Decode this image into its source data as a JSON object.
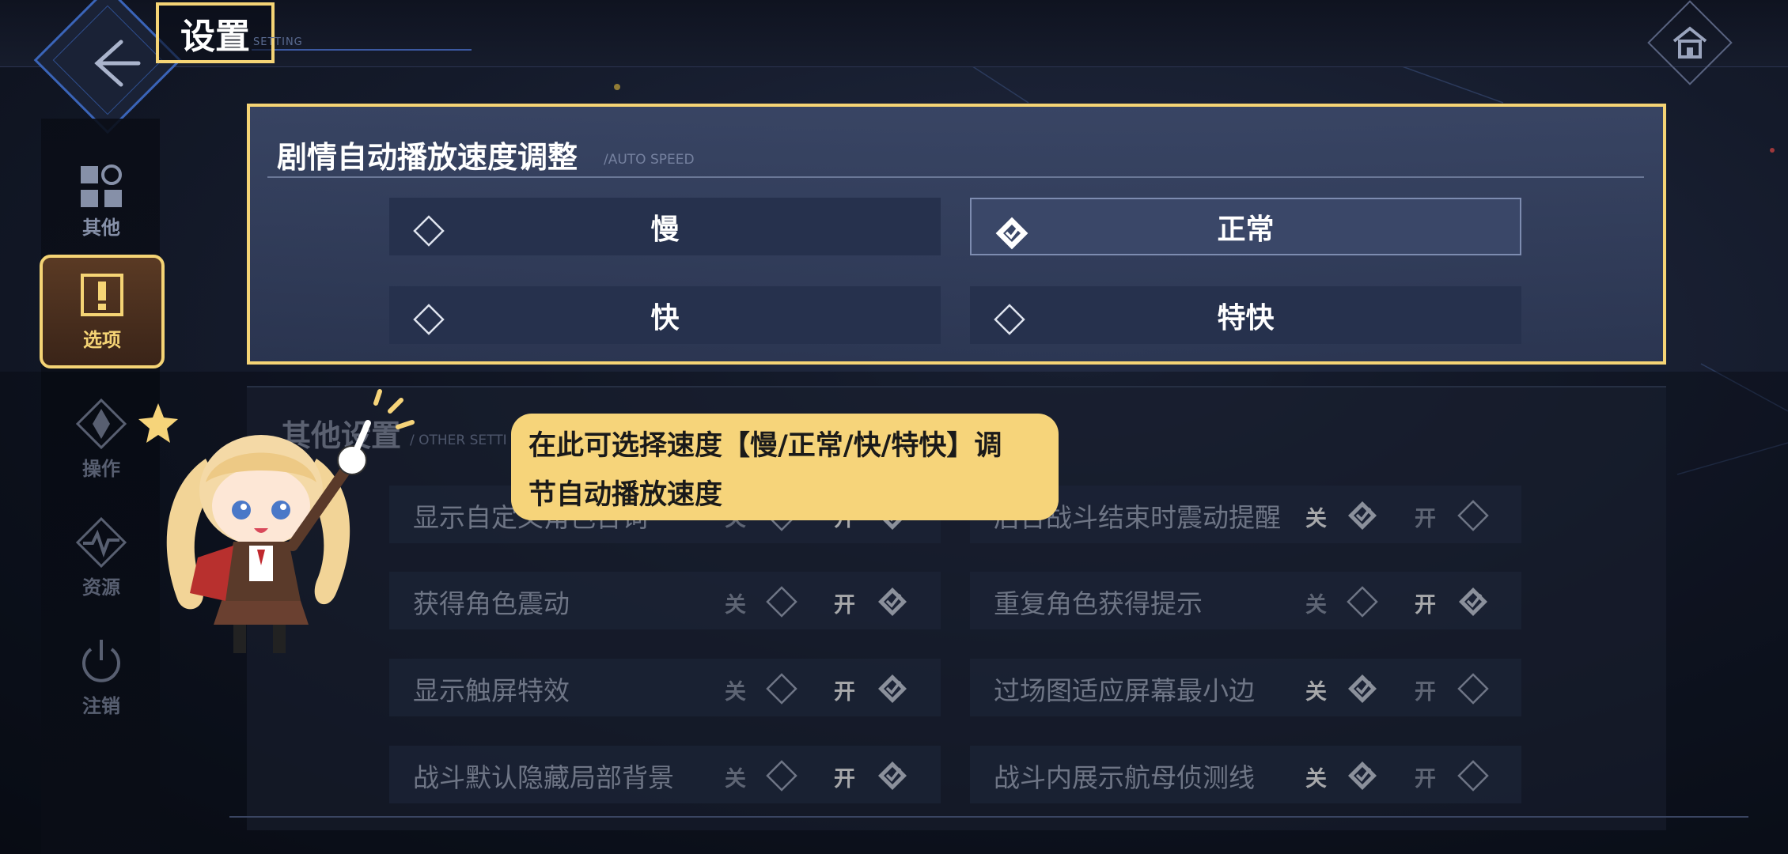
{
  "header": {
    "title": "设置",
    "subtitle": "SETTING"
  },
  "sidebar": {
    "items": [
      {
        "label": "其他",
        "icon": "grid-icon",
        "active": false
      },
      {
        "label": "选项",
        "icon": "option-icon",
        "active": true
      },
      {
        "label": "操作",
        "icon": "control-icon",
        "active": false
      },
      {
        "label": "资源",
        "icon": "resource-icon",
        "active": false
      },
      {
        "label": "注销",
        "icon": "power-icon",
        "active": false
      }
    ]
  },
  "auto_speed": {
    "title": "剧情自动播放速度调整",
    "subtitle": "/AUTO SPEED",
    "options": [
      {
        "label": "慢",
        "selected": false
      },
      {
        "label": "正常",
        "selected": true
      },
      {
        "label": "快",
        "selected": false
      },
      {
        "label": "特快",
        "selected": false
      }
    ]
  },
  "other": {
    "title": "其他设置",
    "subtitle": "/ OTHER SETTI",
    "off_label": "关",
    "on_label": "开",
    "rows": [
      {
        "label": "显示自定义角色台词",
        "value": "on"
      },
      {
        "label": "后台战斗结束时震动提醒",
        "value": "off"
      },
      {
        "label": "获得角色震动",
        "value": "on"
      },
      {
        "label": "重复角色获得提示",
        "value": "on"
      },
      {
        "label": "显示触屏特效",
        "value": "on"
      },
      {
        "label": "过场图适应屏幕最小边",
        "value": "off"
      },
      {
        "label": "战斗默认隐藏局部背景",
        "value": "on"
      },
      {
        "label": "战斗内展示航母侦测线",
        "value": "off"
      }
    ]
  },
  "tooltip": {
    "line1": "在此可选择速度【慢/正常/快/特快】调",
    "line2": "节自动播放速度"
  },
  "colors": {
    "highlight": "#f5d475",
    "panel": "#3e4b6c"
  }
}
